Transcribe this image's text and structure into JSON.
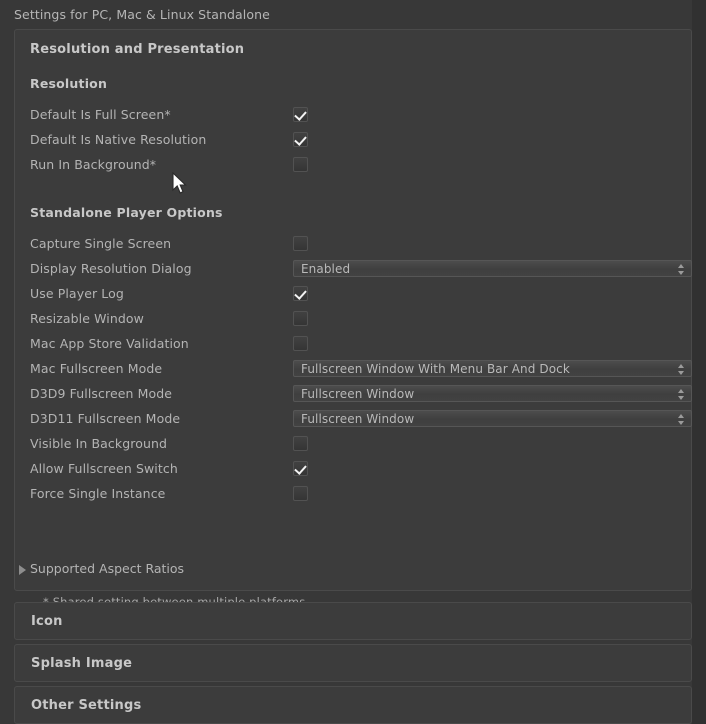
{
  "window": {
    "title": "Settings for PC, Mac & Linux Standalone"
  },
  "resolution_section": {
    "title": "Resolution and Presentation",
    "groups": [
      {
        "heading": "Resolution",
        "rows": [
          {
            "label": "Default Is Full Screen*",
            "control": "checkbox",
            "value": true
          },
          {
            "label": "Default Is Native Resolution",
            "control": "checkbox",
            "value": true
          },
          {
            "label": "Run In Background*",
            "control": "checkbox",
            "value": false
          }
        ]
      },
      {
        "heading": "Standalone Player Options",
        "rows": [
          {
            "label": "Capture Single Screen",
            "control": "checkbox",
            "value": false
          },
          {
            "label": "Display Resolution Dialog",
            "control": "dropdown",
            "value": "Enabled"
          },
          {
            "label": "Use Player Log",
            "control": "checkbox",
            "value": true
          },
          {
            "label": "Resizable Window",
            "control": "checkbox",
            "value": false
          },
          {
            "label": "Mac App Store Validation",
            "control": "checkbox",
            "value": false
          },
          {
            "label": "Mac Fullscreen Mode",
            "control": "dropdown",
            "value": "Fullscreen Window With Menu Bar And Dock"
          },
          {
            "label": "D3D9 Fullscreen Mode",
            "control": "dropdown",
            "value": "Fullscreen Window"
          },
          {
            "label": "D3D11 Fullscreen Mode",
            "control": "dropdown",
            "value": "Fullscreen Window"
          },
          {
            "label": "Visible In Background",
            "control": "checkbox",
            "value": false
          },
          {
            "label": "Allow Fullscreen Switch",
            "control": "checkbox",
            "value": true
          },
          {
            "label": "Force Single Instance",
            "control": "checkbox",
            "value": false
          }
        ]
      }
    ],
    "foldout": {
      "label": "Supported Aspect Ratios",
      "expanded": false
    },
    "footnote": "* Shared setting between multiple platforms."
  },
  "collapsed_sections": [
    {
      "title": "Icon"
    },
    {
      "title": "Splash Image"
    },
    {
      "title": "Other Settings"
    }
  ],
  "colors": {
    "window_background": "#383838",
    "panel_background": "#3c3c3c",
    "panel_border": "#4a4a4a",
    "label_text": "#b4b4b4",
    "heading_text": "#c8c8c8",
    "check_mark": "#f2f2f2"
  },
  "icons": {
    "foldout_collapsed": "triangle-right-icon",
    "dropdown": "updown-arrows-icon",
    "checkmark": "check-icon",
    "cursor": "arrow-cursor-icon"
  }
}
